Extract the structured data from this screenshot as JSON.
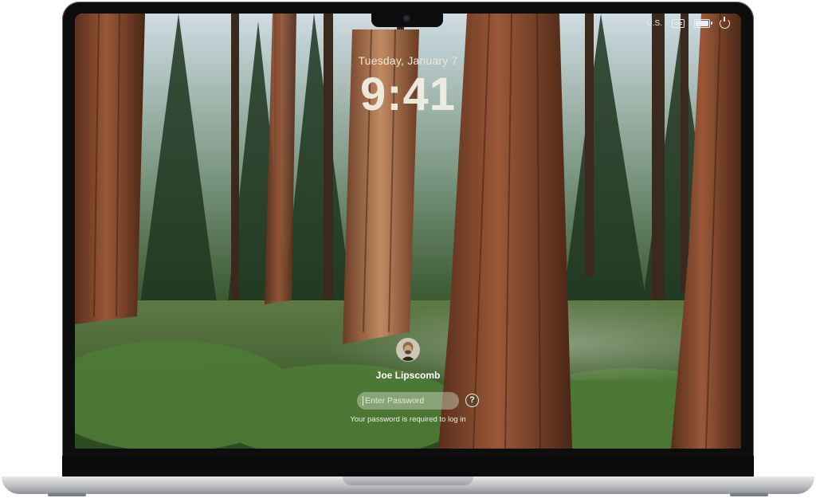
{
  "status_bar": {
    "input_source": "U.S.",
    "keyboard_icon": "keyboard-icon",
    "battery_icon": "battery-icon",
    "power_icon": "power-icon"
  },
  "lock_screen": {
    "date": "Tuesday, January 7",
    "time": "9:41",
    "user": {
      "name": "Joe Lipscomb",
      "avatar_icon": "user-avatar"
    },
    "password": {
      "placeholder": "Enter Password",
      "value": ""
    },
    "help_label": "?",
    "hint": "Your password is required to log in"
  }
}
